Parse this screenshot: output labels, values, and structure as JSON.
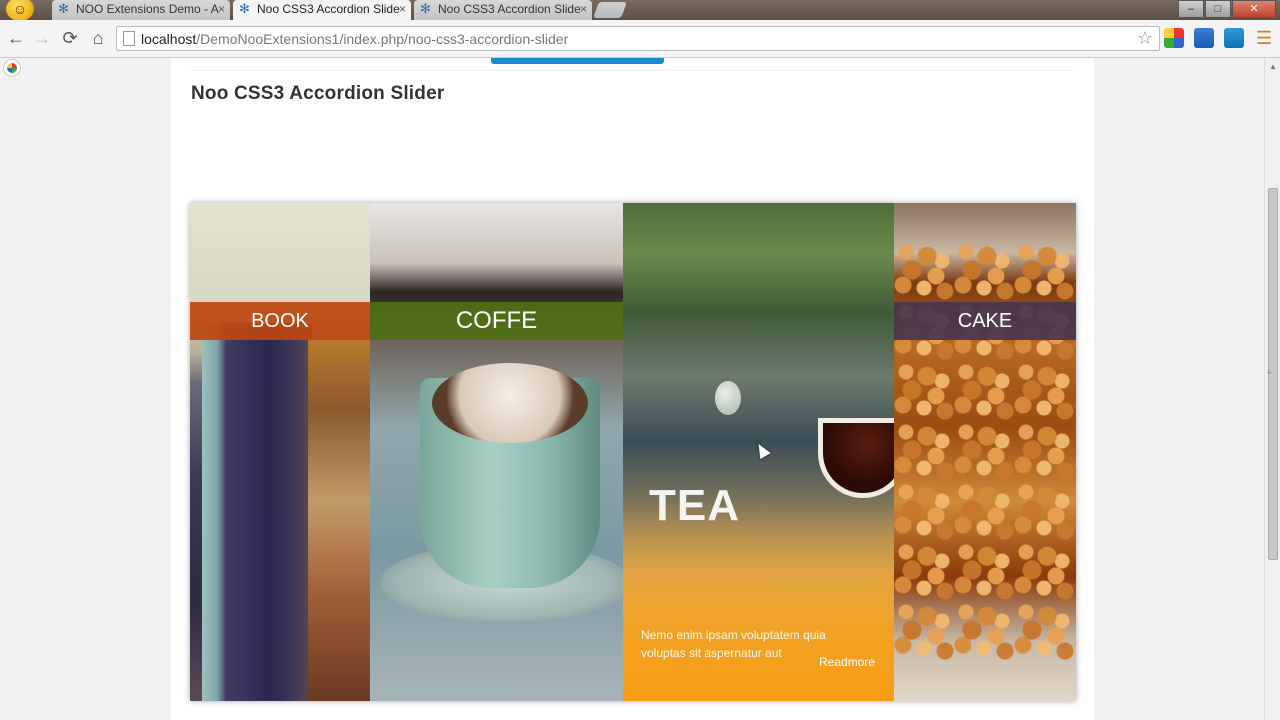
{
  "browser": {
    "tabs": [
      {
        "title": "NOO Extensions Demo - A",
        "active": false
      },
      {
        "title": "Noo CSS3 Accordion Slide",
        "active": true
      },
      {
        "title": "Noo CSS3 Accordion Slide",
        "active": false
      }
    ],
    "close_glyph": "×",
    "url_host": "localhost",
    "url_path": "/DemoNooExtensions1/index.php/noo-css3-accordion-slider",
    "window_controls": {
      "minimize": "–",
      "maximize": "□",
      "close": "✕"
    }
  },
  "page": {
    "title": "Noo CSS3 Accordion Slider"
  },
  "slider": {
    "panels": [
      {
        "label": "BOOK",
        "color": "#be4610"
      },
      {
        "label": "COFFE",
        "color": "#4e7014"
      },
      {
        "label": "TEA",
        "description": "Nemo enim ipsam voluptatem quia voluptas sit aspernatur aut",
        "readmore": "Readmore",
        "color": "#f9a21a"
      },
      {
        "label": "CAKE",
        "color": "#463450"
      }
    ]
  },
  "colors": {
    "accent": "#1a8ad0"
  },
  "icons": {
    "back": "←",
    "forward": "→",
    "reload": "⟳",
    "home": "⌂",
    "star": "☆",
    "menu": "☰"
  }
}
